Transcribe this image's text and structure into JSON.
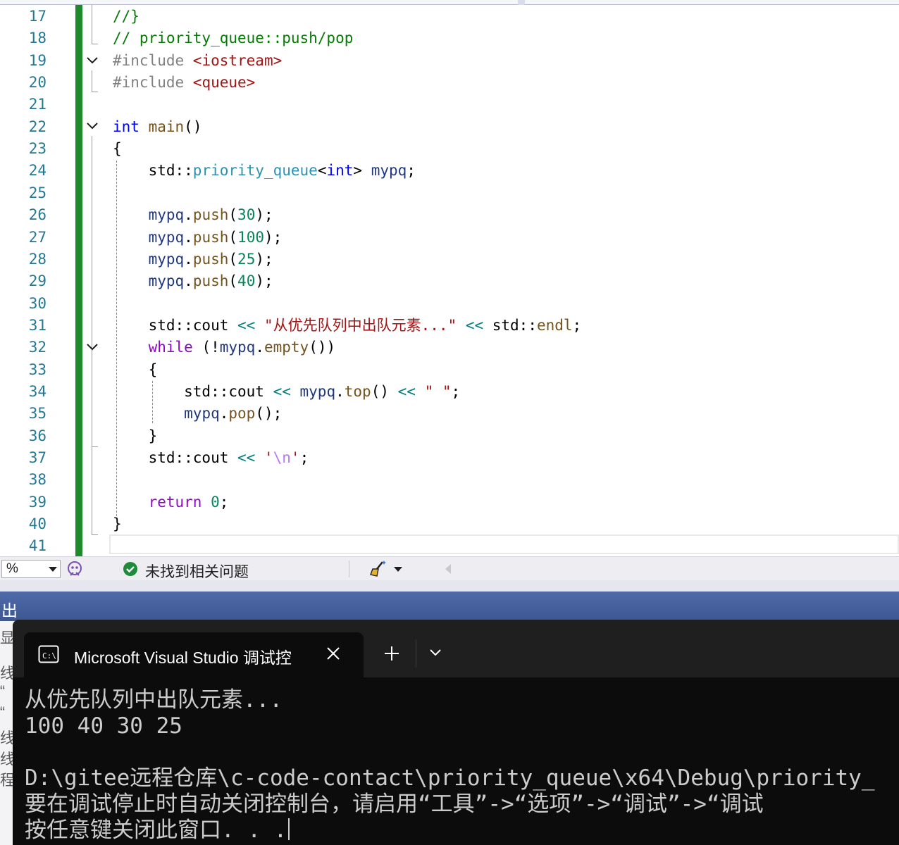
{
  "editor": {
    "line_numbers": [
      "17",
      "18",
      "19",
      "20",
      "21",
      "22",
      "23",
      "24",
      "25",
      "26",
      "27",
      "28",
      "29",
      "30",
      "31",
      "32",
      "33",
      "34",
      "35",
      "36",
      "37",
      "38",
      "39",
      "40",
      "41"
    ],
    "lines": [
      [
        [
          "t-cm",
          "//}"
        ]
      ],
      [
        [
          "t-cm",
          "// priority_queue::push/pop"
        ]
      ],
      [
        [
          "t-pp",
          "#include "
        ],
        [
          "t-str",
          "<iostream>"
        ]
      ],
      [
        [
          "t-pp",
          "#include "
        ],
        [
          "t-str",
          "<queue>"
        ]
      ],
      [],
      [
        [
          "t-kw",
          "int"
        ],
        [
          "",
          "&nbsp;"
        ],
        [
          "t-fn",
          "main"
        ],
        [
          "",
          "()"
        ]
      ],
      [
        [
          "",
          "{"
        ]
      ],
      [
        [
          "",
          "    std::"
        ],
        [
          "t-type",
          "priority_queue"
        ],
        [
          "",
          "<"
        ],
        [
          "t-kw",
          "int"
        ],
        [
          "",
          "> "
        ],
        [
          "t-var",
          "mypq"
        ],
        [
          "",
          ";"
        ]
      ],
      [],
      [
        [
          "",
          "    "
        ],
        [
          "t-var",
          "mypq"
        ],
        [
          "",
          "."
        ],
        [
          "t-fn",
          "push"
        ],
        [
          "",
          "("
        ],
        [
          "t-num",
          "30"
        ],
        [
          "",
          ");"
        ]
      ],
      [
        [
          "",
          "    "
        ],
        [
          "t-var",
          "mypq"
        ],
        [
          "",
          "."
        ],
        [
          "t-fn",
          "push"
        ],
        [
          "",
          "("
        ],
        [
          "t-num",
          "100"
        ],
        [
          "",
          ");"
        ]
      ],
      [
        [
          "",
          "    "
        ],
        [
          "t-var",
          "mypq"
        ],
        [
          "",
          "."
        ],
        [
          "t-fn",
          "push"
        ],
        [
          "",
          "("
        ],
        [
          "t-num",
          "25"
        ],
        [
          "",
          ");"
        ]
      ],
      [
        [
          "",
          "    "
        ],
        [
          "t-var",
          "mypq"
        ],
        [
          "",
          "."
        ],
        [
          "t-fn",
          "push"
        ],
        [
          "",
          "("
        ],
        [
          "t-num",
          "40"
        ],
        [
          "",
          ");"
        ]
      ],
      [],
      [
        [
          "",
          "    std::cout "
        ],
        [
          "t-op",
          "<<"
        ],
        [
          "",
          ""
        ],
        [
          "t-str",
          " \"从优先队列中出队元素...\""
        ],
        [
          "",
          ""
        ],
        [
          "t-op",
          " <<"
        ],
        [
          "",
          " std::"
        ],
        [
          "t-fn",
          "endl"
        ],
        [
          "",
          ";"
        ]
      ],
      [
        [
          "",
          "    "
        ],
        [
          "t-ctl",
          "while"
        ],
        [
          "",
          " (!"
        ],
        [
          "t-var",
          "mypq"
        ],
        [
          "",
          "."
        ],
        [
          "t-fn",
          "empty"
        ],
        [
          "",
          "())"
        ]
      ],
      [
        [
          "",
          "    {"
        ]
      ],
      [
        [
          "",
          "        std::cout "
        ],
        [
          "t-op",
          "<<"
        ],
        [
          "",
          ""
        ],
        [
          "t-var",
          " mypq"
        ],
        [
          "",
          "."
        ],
        [
          "t-fn",
          "top"
        ],
        [
          "",
          "() "
        ],
        [
          "t-op",
          "<<"
        ],
        [
          "t-str",
          " \" \""
        ],
        [
          "",
          ";"
        ]
      ],
      [
        [
          "",
          "        "
        ],
        [
          "t-var",
          "mypq"
        ],
        [
          "",
          "."
        ],
        [
          "t-fn",
          "pop"
        ],
        [
          "",
          "();"
        ]
      ],
      [
        [
          "",
          "    }"
        ]
      ],
      [
        [
          "",
          "    std::cout "
        ],
        [
          "t-op",
          "<<"
        ],
        [
          "t-str",
          " '"
        ],
        [
          "t-esc",
          "\\n"
        ],
        [
          "t-str",
          "'"
        ],
        [
          "",
          ";"
        ]
      ],
      [],
      [
        [
          "",
          "    "
        ],
        [
          "t-ctl",
          "return"
        ],
        [
          "",
          ""
        ],
        [
          "t-num",
          " 0"
        ],
        [
          "",
          ";"
        ]
      ],
      [
        [
          "",
          "}"
        ]
      ],
      []
    ]
  },
  "statusbar": {
    "zoom": "%",
    "issues": "未找到相关问题"
  },
  "output": {
    "title": "出",
    "side_chars": [
      "显",
      "线",
      "“",
      "“",
      "线",
      "线",
      "程"
    ]
  },
  "terminal": {
    "tab_title": "Microsoft Visual Studio 调试控",
    "lines": [
      "从优先队列中出队元素...",
      "100 40 30 25",
      "",
      "D:\\gitee远程仓库\\c-code-contact\\priority_queue\\x64\\Debug\\priority_",
      "要在调试停止时自动关闭控制台，请启用“工具”->“选项”->“调试”->“调试",
      "按任意键关闭此窗口. . ."
    ]
  },
  "colors": {
    "change_bar": "#1e8a2a",
    "line_number": "#237893",
    "output_header": "#3d5793",
    "terminal_bg": "#0c0c0c"
  }
}
